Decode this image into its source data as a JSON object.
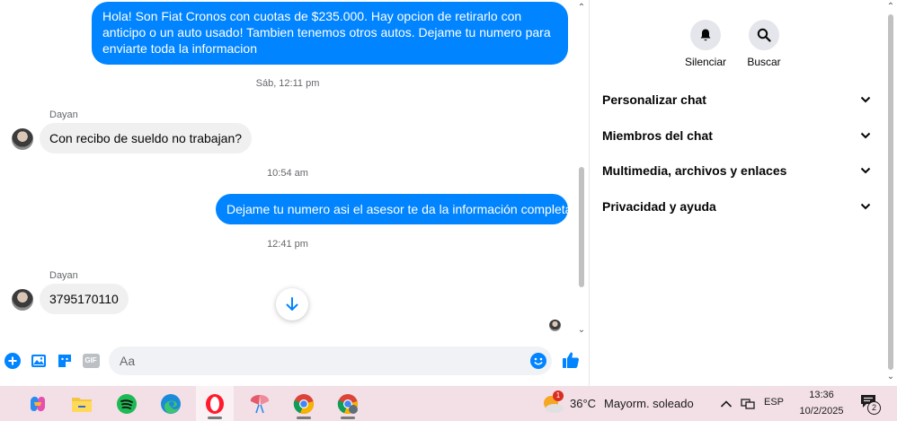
{
  "chat": {
    "messages": [
      {
        "direction": "out",
        "text": "Hola! Son Fiat Cronos con cuotas de $235.000. Hay opcion de retirarlo con anticipo o un auto usado! Tambien tenemos otros autos. Dejame tu numero para enviarte toda la informacion"
      },
      {
        "type": "timestamp",
        "text": "Sáb, 12:11 pm"
      },
      {
        "direction": "in",
        "sender": "Dayan",
        "text": "Con recibo de sueldo no trabajan?"
      },
      {
        "type": "timestamp",
        "text": "10:54 am"
      },
      {
        "direction": "out",
        "text": "Dejame tu numero asi el asesor te da la información completa"
      },
      {
        "type": "timestamp",
        "text": "12:41 pm"
      },
      {
        "direction": "in",
        "sender": "Dayan",
        "text": "3795170110"
      }
    ],
    "composer": {
      "placeholder": "Aa",
      "value": "",
      "icons": [
        "plus-circle-icon",
        "photo-icon",
        "sticker-icon",
        "gif-icon",
        "emoji-icon",
        "like-icon"
      ],
      "gif_label": "GIF"
    },
    "accent_color": "#0084ff"
  },
  "panel": {
    "actions": [
      {
        "label": "Silenciar",
        "icon": "bell-icon"
      },
      {
        "label": "Buscar",
        "icon": "search-icon"
      }
    ],
    "sections": [
      {
        "label": "Personalizar chat"
      },
      {
        "label": "Miembros del chat"
      },
      {
        "label": "Multimedia, archivos y enlaces"
      },
      {
        "label": "Privacidad y ayuda"
      }
    ]
  },
  "taskbar": {
    "apps": [
      "copilot-icon",
      "file-explorer-icon",
      "spotify-icon",
      "edge-icon",
      "opera-icon",
      "app-icon",
      "chrome-icon",
      "chrome-profile-icon"
    ],
    "weather": {
      "temp": "36°C",
      "condition": "Mayorm. soleado",
      "badge": "1"
    },
    "language": "ESP",
    "time": "13:36",
    "date": "10/2/2025",
    "notifications": "2"
  }
}
